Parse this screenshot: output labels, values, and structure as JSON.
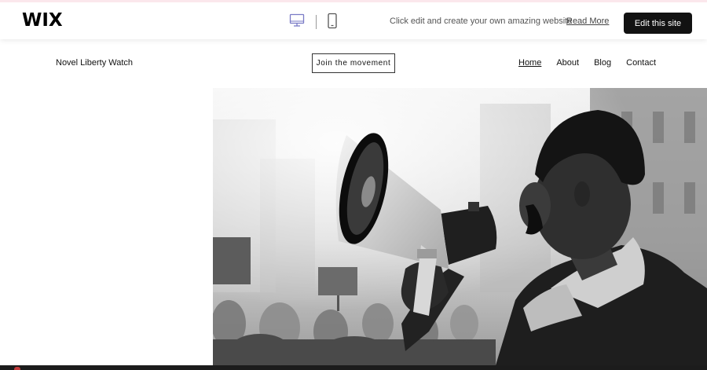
{
  "wix_bar": {
    "logo": "WIX",
    "prompt": "Click edit and create your own amazing website",
    "read_more": "Read More",
    "edit_button": "Edit this site",
    "devices": {
      "desktop": "desktop-icon",
      "mobile": "mobile-icon",
      "active": "desktop"
    },
    "accent_color": "#7a7bc6"
  },
  "site": {
    "title": "Novel Liberty Watch",
    "cta": "Join the movement",
    "nav": [
      {
        "label": "Home",
        "active": true
      },
      {
        "label": "About",
        "active": false
      },
      {
        "label": "Blog",
        "active": false
      },
      {
        "label": "Contact",
        "active": false
      }
    ]
  },
  "hero": {
    "image": "black-and-white photo of a man shouting into a megaphone at a protest crowd"
  }
}
